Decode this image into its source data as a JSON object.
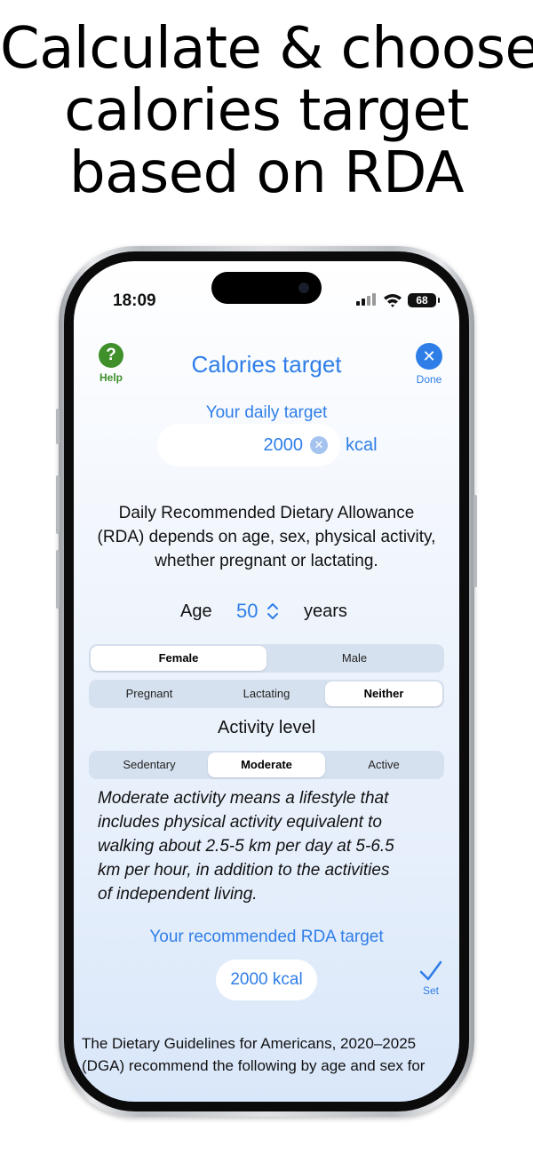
{
  "headline": [
    "Calculate & choose",
    "calories target",
    "based on RDA"
  ],
  "status_bar": {
    "time": "18:09",
    "battery": "68"
  },
  "header": {
    "help_label": "Help",
    "help_glyph": "?",
    "title": "Calories target",
    "done_label": "Done",
    "done_glyph": "✕"
  },
  "daily_target": {
    "label": "Your daily target",
    "value": "2000",
    "unit": "kcal"
  },
  "rda_description": [
    "Daily Recommended Dietary Allowance",
    "(RDA) depends on age, sex, physical activity,",
    "whether pregnant or lactating."
  ],
  "age": {
    "label": "Age",
    "value": "50",
    "unit": "years"
  },
  "sex_options": [
    "Female",
    "Male"
  ],
  "sex_selected": "Female",
  "status_options": [
    "Pregnant",
    "Lactating",
    "Neither"
  ],
  "status_selected": "Neither",
  "activity": {
    "title": "Activity level",
    "options": [
      "Sedentary",
      "Moderate",
      "Active"
    ],
    "selected": "Moderate",
    "description": [
      "Moderate activity means a lifestyle that",
      "includes physical activity equivalent to",
      "walking about 2.5-5 km per day at 5-6.5",
      "km per hour, in addition to the activities",
      "of independent living."
    ]
  },
  "recommended": {
    "label": "Your recommended RDA target",
    "value": "2000 kcal",
    "set_label": "Set"
  },
  "dga_text": [
    "The Dietary Guidelines for Americans, 2020–2025",
    "(DGA) recommend the following by age and sex for"
  ],
  "colors": {
    "accent": "#2f7ee8",
    "help_green": "#3f8f2a"
  }
}
